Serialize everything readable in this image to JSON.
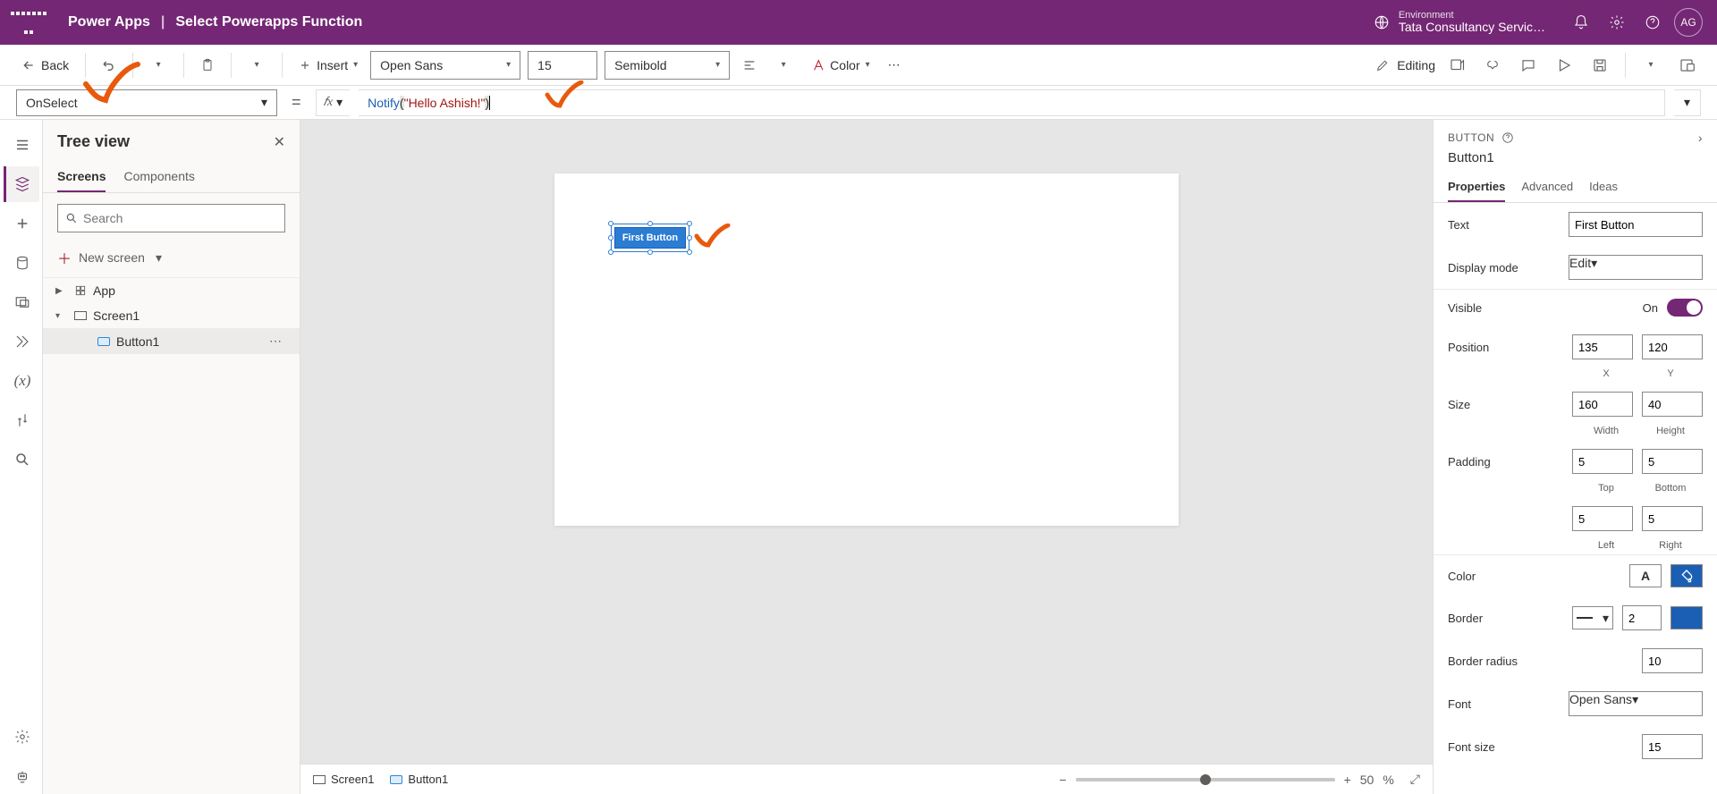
{
  "header": {
    "app": "Power Apps",
    "page": "Select Powerapps Function",
    "env_label": "Environment",
    "env_name": "Tata Consultancy Servic…",
    "avatar": "AG"
  },
  "cmdbar": {
    "back": "Back",
    "insert": "Insert",
    "font": "Open Sans",
    "fontsize": "15",
    "weight": "Semibold",
    "color": "Color",
    "editing": "Editing"
  },
  "fxbar": {
    "property": "OnSelect",
    "fn": "Notify",
    "arg": "\"Hello Ashish!\""
  },
  "tree": {
    "title": "Tree view",
    "tab_screens": "Screens",
    "tab_components": "Components",
    "search_placeholder": "Search",
    "new_screen": "New screen",
    "app": "App",
    "screen1": "Screen1",
    "button1": "Button1"
  },
  "canvas": {
    "button_text": "First Button",
    "bc_screen": "Screen1",
    "bc_button": "Button1",
    "zoom": "50",
    "zoom_unit": "%"
  },
  "props": {
    "type": "BUTTON",
    "name": "Button1",
    "tab_properties": "Properties",
    "tab_advanced": "Advanced",
    "tab_ideas": "Ideas",
    "text_lbl": "Text",
    "text_val": "First Button",
    "display_lbl": "Display mode",
    "display_val": "Edit",
    "visible_lbl": "Visible",
    "visible_val": "On",
    "position_lbl": "Position",
    "pos_x": "135",
    "pos_y": "120",
    "sub_x": "X",
    "sub_y": "Y",
    "size_lbl": "Size",
    "size_w": "160",
    "size_h": "40",
    "sub_w": "Width",
    "sub_h": "Height",
    "padding_lbl": "Padding",
    "pad_t": "5",
    "pad_b": "5",
    "pad_l": "5",
    "pad_r": "5",
    "sub_t": "Top",
    "sub_b": "Bottom",
    "sub_l": "Left",
    "sub_r": "Right",
    "color_lbl": "Color",
    "border_lbl": "Border",
    "border_val": "2",
    "radius_lbl": "Border radius",
    "radius_val": "10",
    "font_lbl": "Font",
    "font_val": "Open Sans",
    "fontsize_lbl": "Font size",
    "fontsize_val": "15"
  }
}
